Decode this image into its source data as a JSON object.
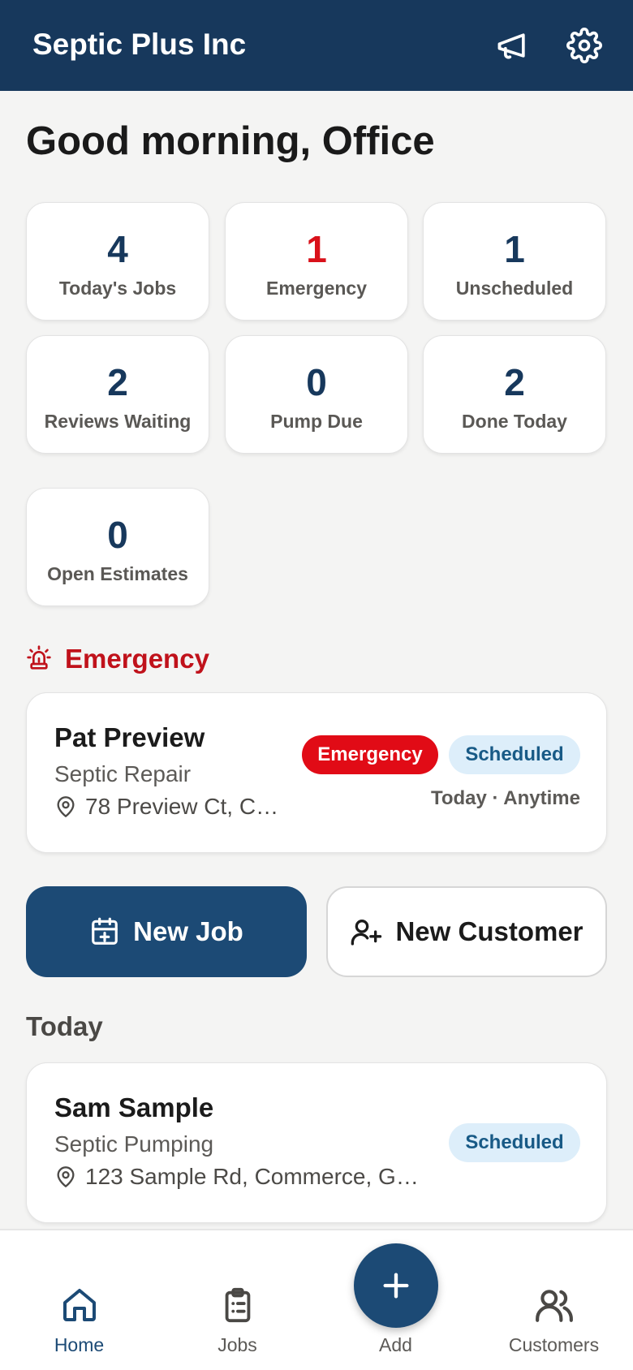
{
  "header": {
    "title": "Septic Plus Inc",
    "icons": [
      "megaphone-icon",
      "gear-icon"
    ]
  },
  "greeting": "Good morning, Office",
  "stats": [
    {
      "value": "4",
      "label": "Today's Jobs"
    },
    {
      "value": "1",
      "label": "Emergency"
    },
    {
      "value": "1",
      "label": "Unscheduled"
    },
    {
      "value": "2",
      "label": "Reviews Waiting"
    },
    {
      "value": "0",
      "label": "Pump Due"
    },
    {
      "value": "2",
      "label": "Done Today"
    },
    {
      "value": "0",
      "label": "Open Estimates"
    }
  ],
  "emergency_section": {
    "title": "Emergency",
    "icon": "siren-icon",
    "job": {
      "name": "Pat Preview",
      "service": "Septic Repair",
      "address": "78 Preview Ct, C…",
      "badges": [
        "Emergency",
        "Scheduled"
      ],
      "when": "Today · Anytime"
    }
  },
  "actions": {
    "new_job": "New Job",
    "new_customer": "New Customer"
  },
  "today_section": {
    "title": "Today",
    "jobs": [
      {
        "name": "Sam Sample",
        "service": "Septic Pumping",
        "address": "123 Sample Rd, Commerce, G…",
        "status": "Scheduled"
      }
    ]
  },
  "nav": {
    "items": [
      {
        "label": "Home",
        "icon": "home-icon",
        "active": true
      },
      {
        "label": "Jobs",
        "icon": "clipboard-icon"
      },
      {
        "label": "Add",
        "icon": "plus-icon"
      },
      {
        "label": "Customers",
        "icon": "users-icon"
      }
    ]
  },
  "colors": {
    "header_bg": "#17385c",
    "primary": "#1c4a75",
    "emergency_red": "#e10b16",
    "scheduled_bg": "#ddeefa",
    "scheduled_text": "#185a86"
  }
}
